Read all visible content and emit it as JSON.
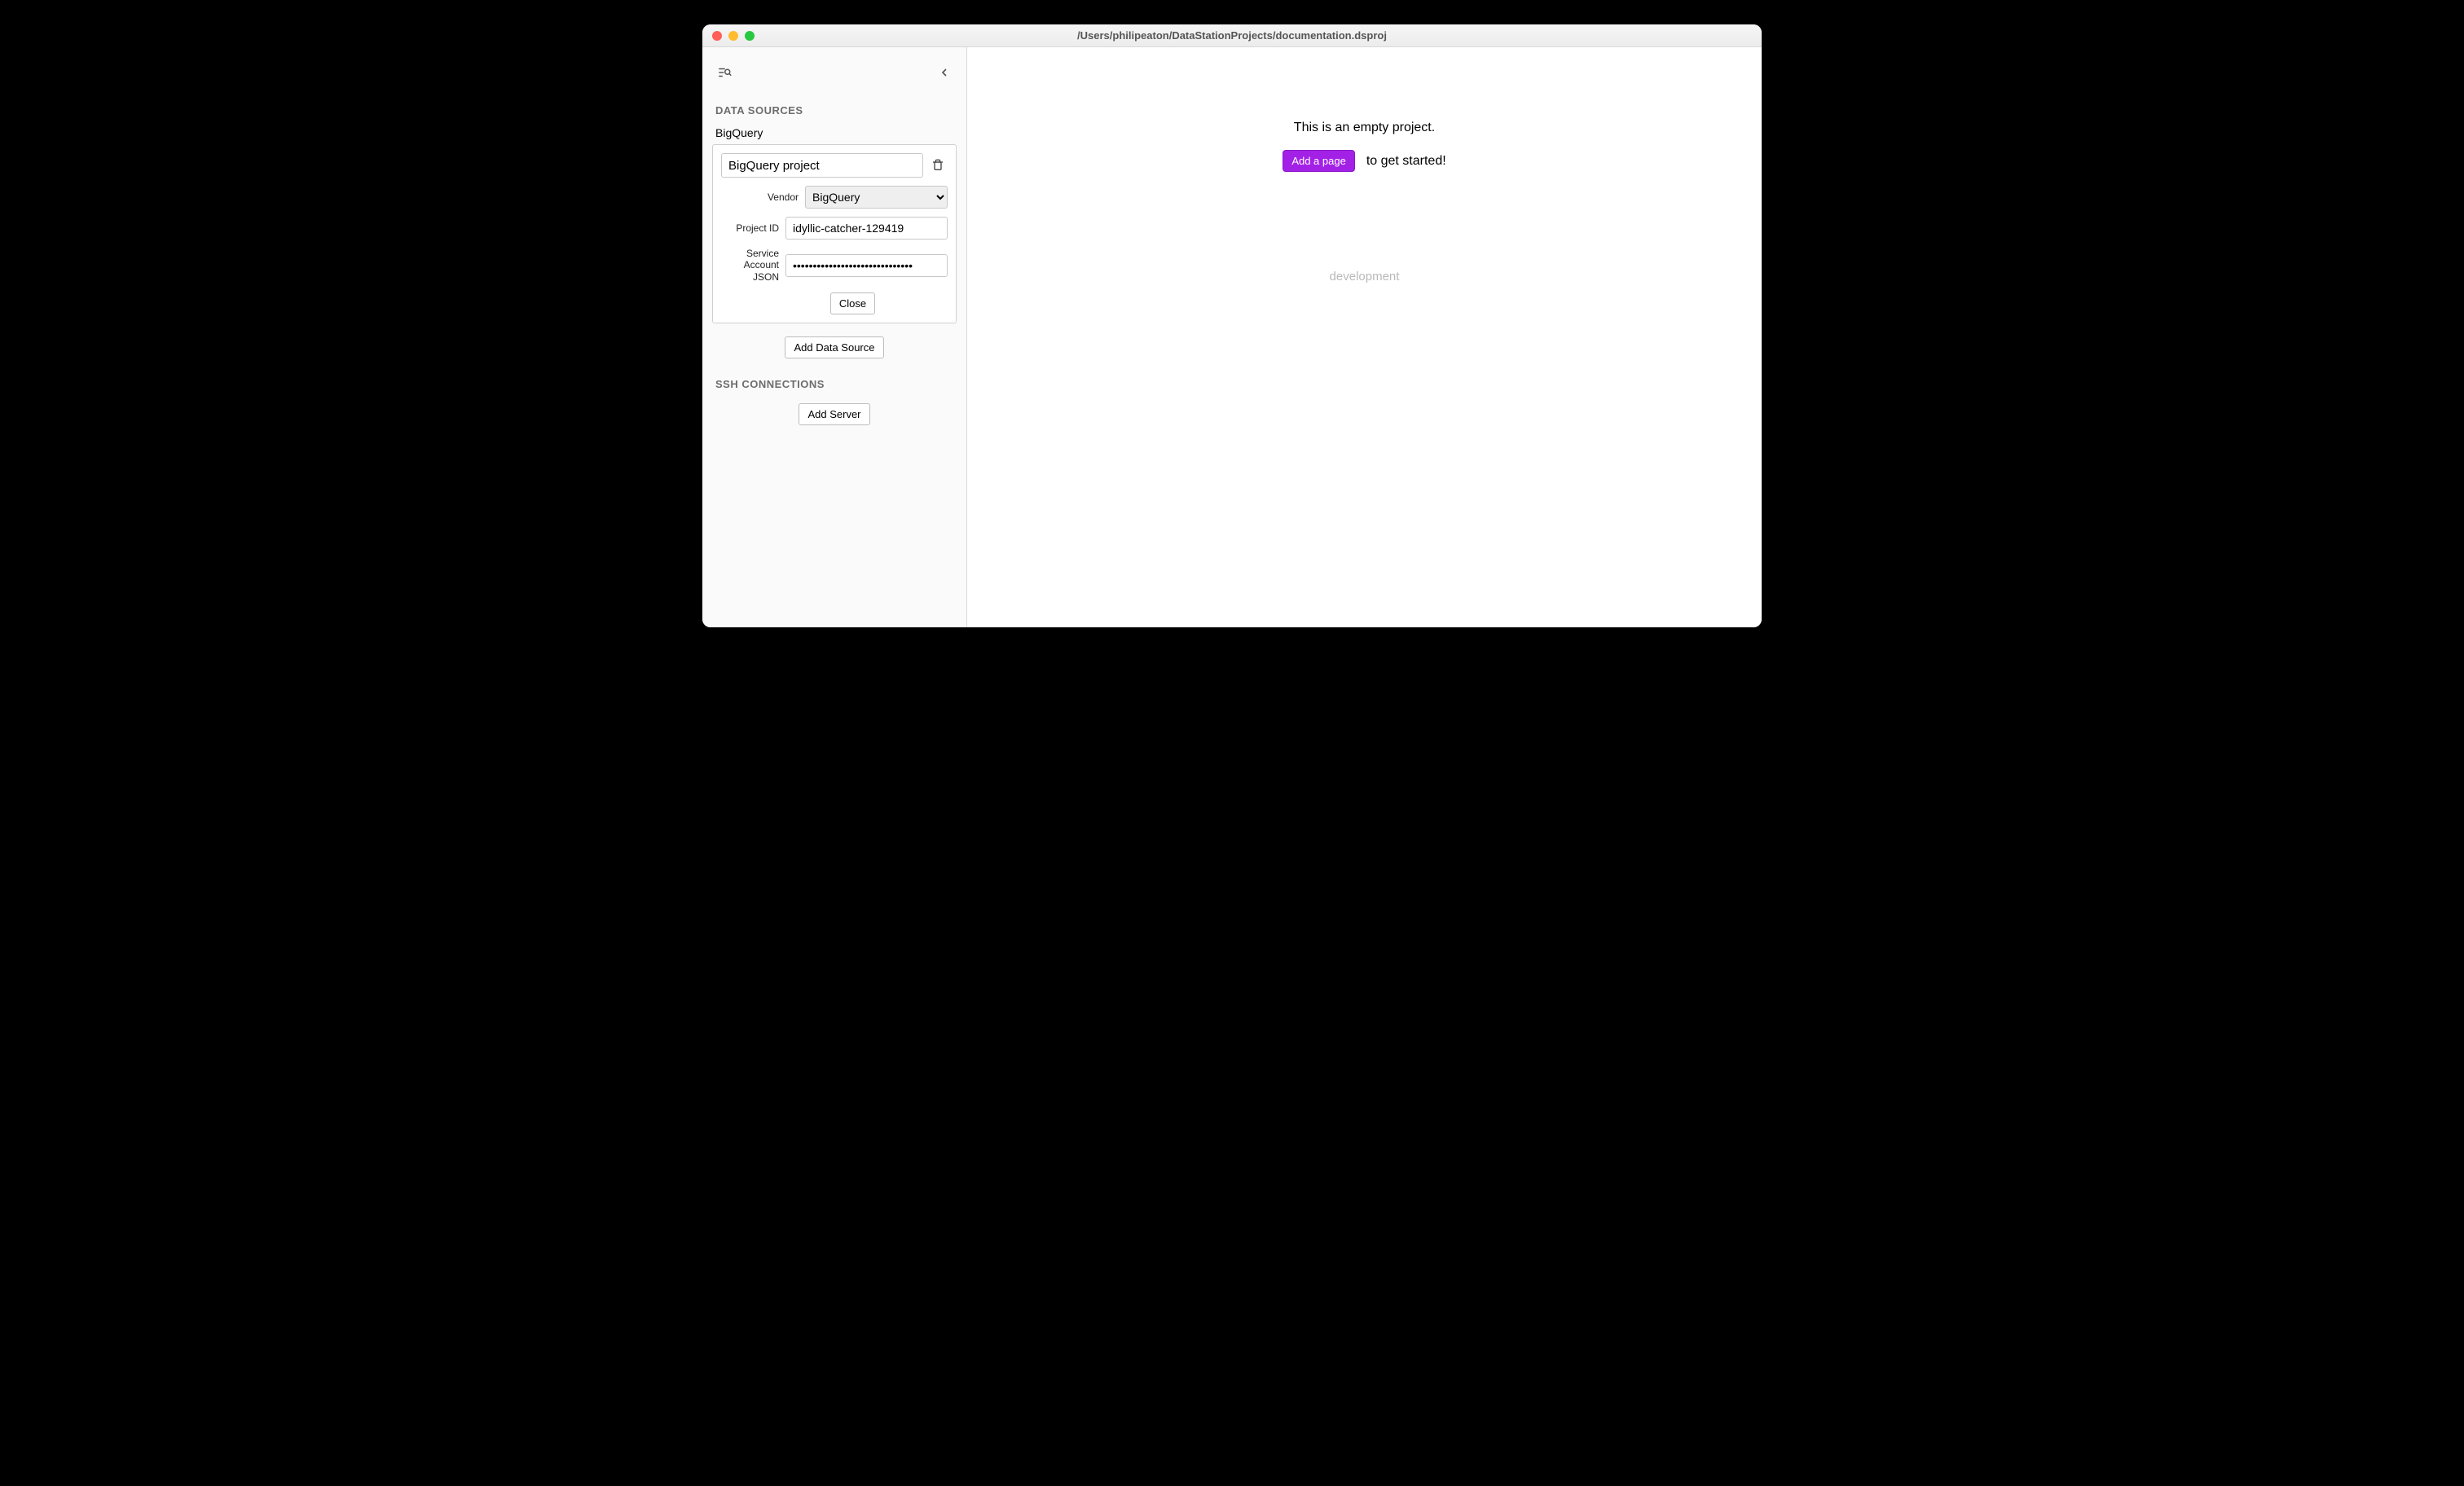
{
  "window": {
    "title": "/Users/philipeaton/DataStationProjects/documentation.dsproj"
  },
  "sidebar": {
    "sections": {
      "data_sources": {
        "heading": "DATA SOURCES",
        "items": [
          {
            "label": "BigQuery",
            "card": {
              "name_value": "BigQuery project",
              "vendor_label": "Vendor",
              "vendor_value": "BigQuery",
              "project_id_label": "Project ID",
              "project_id_value": "idyllic-catcher-129419",
              "service_account_label": "Service Account JSON",
              "service_account_value": "••••••••••••••••••••••••••••••",
              "close_button": "Close"
            }
          }
        ],
        "add_button": "Add Data Source"
      },
      "ssh": {
        "heading": "SSH CONNECTIONS",
        "add_button": "Add Server"
      }
    }
  },
  "main": {
    "empty_message": "This is an empty project.",
    "add_page_button": "Add a page",
    "cta_suffix": "to get started!",
    "environment": "development"
  }
}
